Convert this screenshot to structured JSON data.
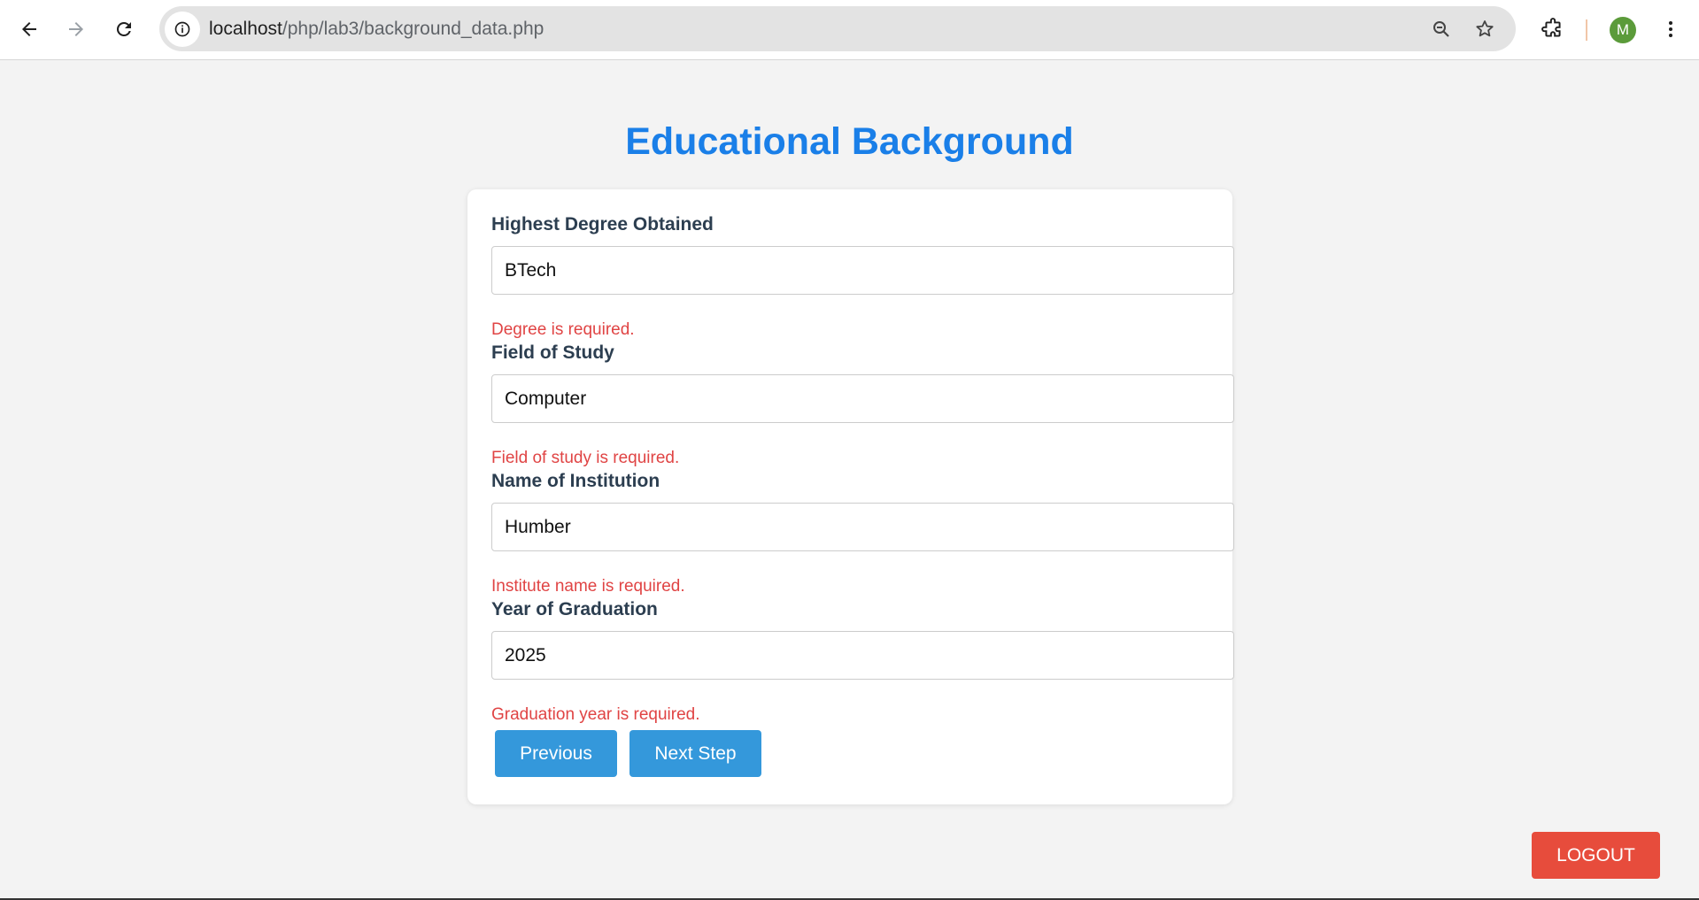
{
  "browser": {
    "url_host": "localhost",
    "url_path": "/php/lab3/background_data.php",
    "profile_initial": "M"
  },
  "page": {
    "title": "Educational Background"
  },
  "form": {
    "fields": [
      {
        "label": "Highest Degree Obtained",
        "value": "BTech",
        "error": "Degree is required."
      },
      {
        "label": "Field of Study",
        "value": "Computer",
        "error": "Field of study is required."
      },
      {
        "label": "Name of Institution",
        "value": "Humber",
        "error": "Institute name is required."
      },
      {
        "label": "Year of Graduation",
        "value": "2025",
        "error": "Graduation year is required."
      }
    ],
    "previous_label": "Previous",
    "next_label": "Next Step"
  },
  "logout_label": "LOGOUT",
  "colors": {
    "title": "#1a7fe8",
    "button": "#3498db",
    "logout": "#e74c3c",
    "error": "#e04444"
  }
}
